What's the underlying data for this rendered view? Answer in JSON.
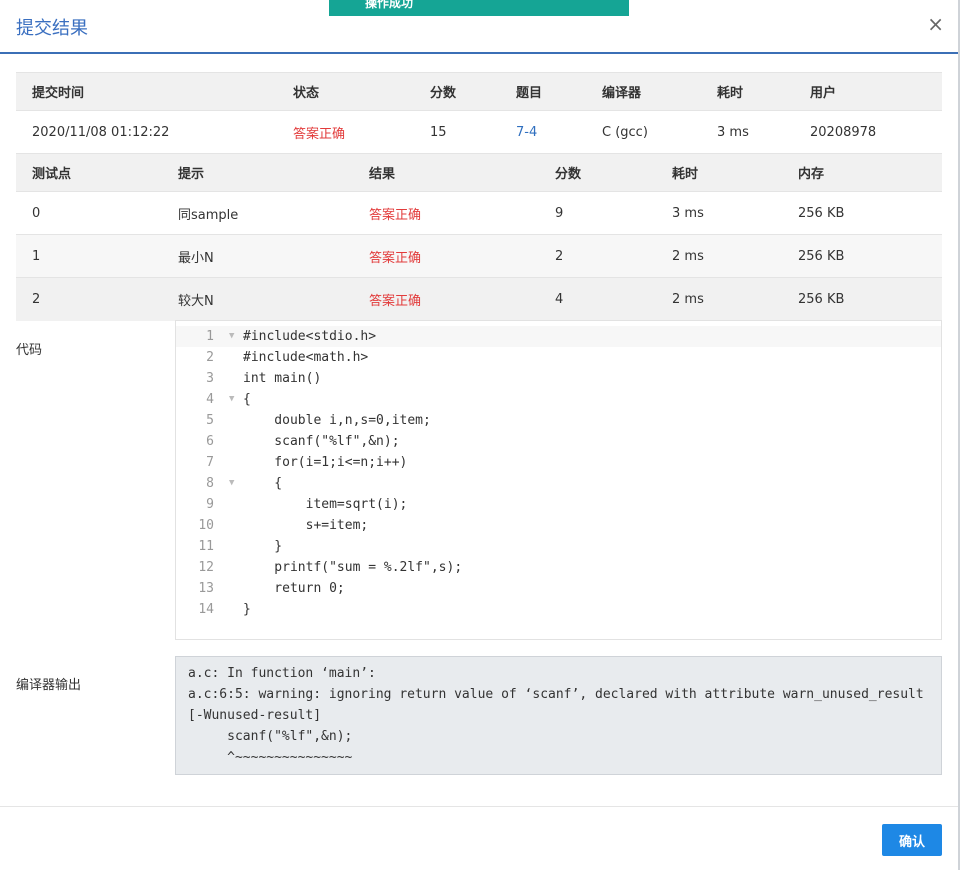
{
  "toast": {
    "text": "操作成功"
  },
  "dialog": {
    "title": "提交结果",
    "close_glyph": "×"
  },
  "summary": {
    "headers": [
      "提交时间",
      "状态",
      "分数",
      "题目",
      "编译器",
      "耗时",
      "用户"
    ],
    "row": {
      "time": "2020/11/08 01:12:22",
      "status": "答案正确",
      "score": "15",
      "problem": "7-4",
      "compiler": "C (gcc)",
      "duration": "3 ms",
      "user": "20208978"
    }
  },
  "testcases": {
    "headers": [
      "测试点",
      "提示",
      "结果",
      "分数",
      "耗时",
      "内存"
    ],
    "rows": [
      {
        "id": "0",
        "hint": "同sample",
        "result": "答案正确",
        "score": "9",
        "time": "3 ms",
        "memory": "256 KB"
      },
      {
        "id": "1",
        "hint": "最小N",
        "result": "答案正确",
        "score": "2",
        "time": "2 ms",
        "memory": "256 KB"
      },
      {
        "id": "2",
        "hint": "较大N",
        "result": "答案正确",
        "score": "4",
        "time": "2 ms",
        "memory": "256 KB"
      }
    ]
  },
  "code_label": "代码",
  "code_lines": [
    "#include<stdio.h>",
    "#include<math.h>",
    "int main()",
    "{",
    "    double i,n,s=0,item;",
    "    scanf(\"%lf\",&n);",
    "    for(i=1;i<=n;i++)",
    "    {",
    "        item=sqrt(i);",
    "        s+=item;",
    "    }",
    "    printf(\"sum = %.2lf\",s);",
    "    return 0;",
    "}"
  ],
  "compiler_label": "编译器输出",
  "compiler_output": "a.c: In function ‘main’:\na.c:6:5: warning: ignoring return value of ‘scanf’, declared with attribute warn_unused_result\n[-Wunused-result]\n     scanf(\"%lf\",&n);\n     ^~~~~~~~~~~~~~~~",
  "confirm_label": "确认",
  "colors": {
    "accent": "#3a6fc0",
    "success_text": "#e23b3b",
    "toast_bg": "#15a595",
    "button": "#1e88e5"
  }
}
